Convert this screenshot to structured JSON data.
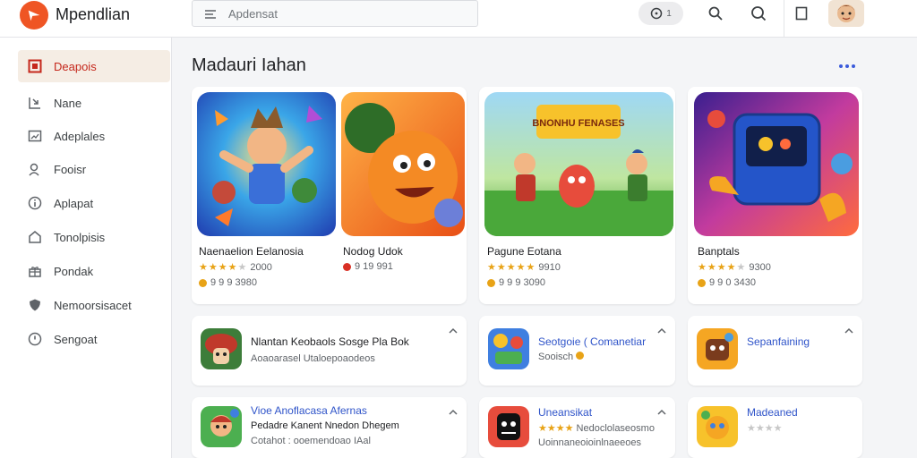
{
  "app": {
    "title": "Mpendlian"
  },
  "search": {
    "placeholder": "Apdensat"
  },
  "toolbar": {
    "pill_count": "1"
  },
  "sidebar": {
    "items": [
      {
        "label": "Deapois",
        "icon": "square-icon",
        "active": true
      },
      {
        "label": "Nane",
        "icon": "import-icon",
        "active": false
      },
      {
        "label": "Adeplales",
        "icon": "image-icon",
        "active": false
      },
      {
        "label": "Fooisr",
        "icon": "user-icon",
        "active": false
      },
      {
        "label": "Aplapat",
        "icon": "info-icon",
        "active": false
      },
      {
        "label": "Tonolpisis",
        "icon": "home-icon",
        "active": false
      },
      {
        "label": "Pondak",
        "icon": "gift-icon",
        "active": false
      },
      {
        "label": "Nemoorsisacet",
        "icon": "shield-icon",
        "active": false
      },
      {
        "label": "Sengoat",
        "icon": "clock-icon",
        "active": false
      }
    ]
  },
  "main": {
    "section_title": "Madauri Iahan",
    "featured": [
      {
        "title": "Naenaelion Eelanosia",
        "rating_text": "2000",
        "stars": 4,
        "meta": "9 9 9 3980",
        "art": "hero-blue"
      },
      {
        "title": "Nodog Udok",
        "rating_text": "",
        "stars": 0,
        "meta": "9 19 991",
        "art": "orange-monster"
      },
      {
        "title": "Pagune Eotana",
        "rating_text": "9910",
        "stars": 5,
        "meta": "9 9 9 3090",
        "art": "field-heroes"
      },
      {
        "title": "Banptals",
        "rating_text": "9300",
        "stars": 4,
        "meta": "9 9 0 3430",
        "art": "console"
      }
    ],
    "featured_art_banner": "BNONHU FENASES",
    "list": [
      {
        "line1": "Nlantan Keobaols Sosge Pla Bok",
        "line2": "Aoaoarasel Utaloepoaodeos",
        "line3": "",
        "blue": false,
        "thumb": "red-mushroom"
      },
      {
        "line1": "Seotgoie ( Comanetiar",
        "line2": "Sooisch",
        "line3": "",
        "blue": true,
        "thumb": "blue-puzzle"
      },
      {
        "line1": "Sepanfaining",
        "line2": "",
        "line3": "",
        "blue": true,
        "thumb": "yellow-robot"
      },
      {
        "line1": "Vioe Anoflacasa Afernas",
        "line2": "Pedadre Kanent Nnedon Dhegem",
        "line3": "Cotahot : ooemendoao IAal",
        "blue": true,
        "thumb": "boy-hero"
      },
      {
        "line1": "Uneansikat",
        "line2": "Nedoclolaseosmo",
        "line3": "Uoinnaneoioinlnaeeoes",
        "blue": true,
        "thumb": "black-monster"
      },
      {
        "line1": "Madeaned",
        "line2": "",
        "line3": "",
        "blue": true,
        "thumb": "yellow-robot-2"
      }
    ]
  },
  "colors": {
    "accent": "#ef5524",
    "active_text": "#c5281c",
    "link_blue": "#2f54c9",
    "star": "#e8a317"
  }
}
